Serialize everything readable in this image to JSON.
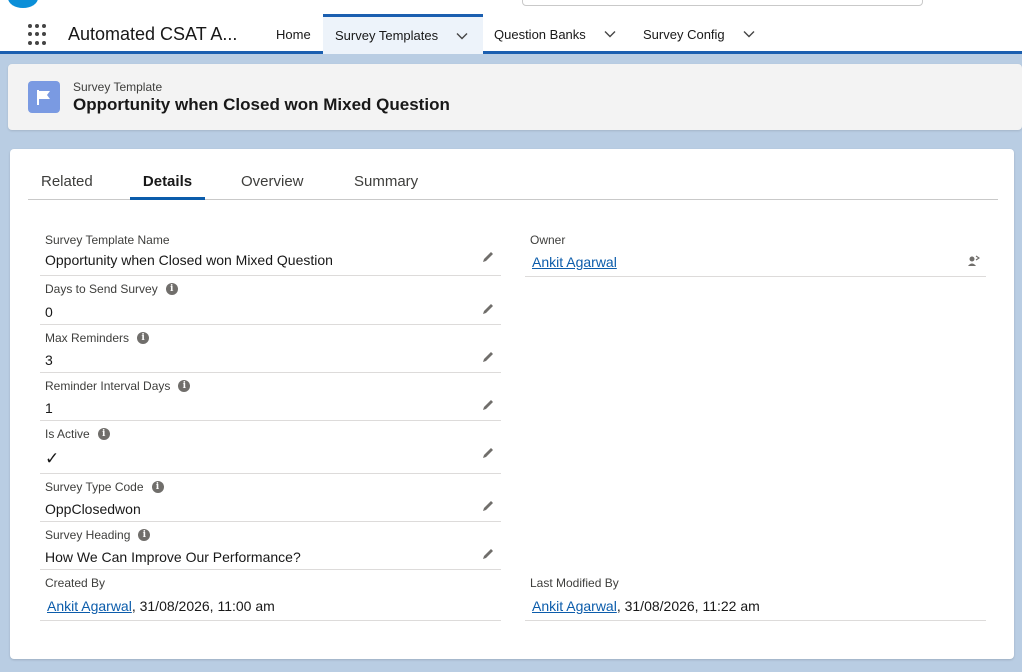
{
  "app": {
    "name": "Automated CSAT A..."
  },
  "nav": {
    "items": [
      {
        "label": "Home"
      },
      {
        "label": "Survey Templates"
      },
      {
        "label": "Question Banks"
      },
      {
        "label": "Survey Config"
      }
    ]
  },
  "header": {
    "record_type": "Survey Template",
    "title": "Opportunity when Closed won Mixed Question"
  },
  "tabs": [
    {
      "label": "Related"
    },
    {
      "label": "Details"
    },
    {
      "label": "Overview"
    },
    {
      "label": "Summary"
    }
  ],
  "fields": {
    "template_name": {
      "label": "Survey Template Name",
      "value": "Opportunity when Closed won Mixed Question"
    },
    "days_to_send": {
      "label": "Days to Send Survey",
      "value": "0"
    },
    "max_reminders": {
      "label": "Max Reminders",
      "value": "3"
    },
    "reminder_interval": {
      "label": "Reminder Interval Days",
      "value": "1"
    },
    "is_active": {
      "label": "Is Active",
      "value": "✓"
    },
    "survey_type_code": {
      "label": "Survey Type Code",
      "value": "OppClosedwon"
    },
    "survey_heading": {
      "label": "Survey Heading",
      "value": "How We Can Improve Our Performance?"
    },
    "created_by": {
      "label": "Created By",
      "user": "Ankit Agarwal",
      "timestamp": ", 31/08/2026, 11:00 am"
    },
    "owner": {
      "label": "Owner",
      "value": "Ankit Agarwal"
    },
    "last_modified_by": {
      "label": "Last Modified By",
      "user": "Ankit Agarwal",
      "timestamp": ", 31/08/2026, 11:22 am"
    }
  },
  "colors": {
    "brand_blue": "#0b5cab",
    "nav_underline": "#1b5fb0",
    "record_icon": "#7a9ae2",
    "background": "#b9cde3"
  },
  "icons": {
    "app_launcher": "grid-icon",
    "record": "flag-icon",
    "edit": "pencil-icon",
    "info": "info-icon",
    "change_owner": "change-owner-icon"
  }
}
